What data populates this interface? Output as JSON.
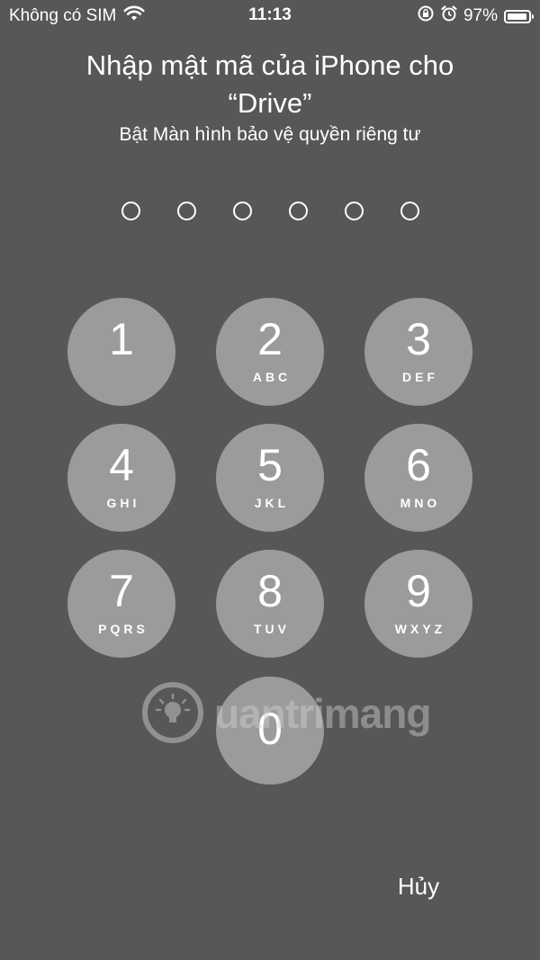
{
  "status_bar": {
    "carrier": "Không có SIM",
    "time": "11:13",
    "battery": "97%",
    "battery_level": 0.97,
    "icons": [
      "wifi-icon",
      "rotation-lock-icon",
      "alarm-icon",
      "battery-icon"
    ]
  },
  "prompt": {
    "title_line1": "Nhập mật mã của iPhone cho",
    "title_line2": "“Drive”",
    "subtitle": "Bật Màn hình bảo vệ quyền riêng tư"
  },
  "passcode": {
    "length": 6,
    "entered": 0
  },
  "keypad": [
    {
      "digit": "1",
      "letters": ""
    },
    {
      "digit": "2",
      "letters": "ABC"
    },
    {
      "digit": "3",
      "letters": "DEF"
    },
    {
      "digit": "4",
      "letters": "GHI"
    },
    {
      "digit": "5",
      "letters": "JKL"
    },
    {
      "digit": "6",
      "letters": "MNO"
    },
    {
      "digit": "7",
      "letters": "PQRS"
    },
    {
      "digit": "8",
      "letters": "TUV"
    },
    {
      "digit": "9",
      "letters": "WXYZ"
    },
    {
      "digit": "0",
      "letters": ""
    }
  ],
  "watermark": {
    "text": "uantrimang"
  },
  "actions": {
    "cancel": "Hủy"
  },
  "colors": {
    "background": "#575757",
    "key": "#9b9b9b",
    "text": "#ffffff"
  }
}
